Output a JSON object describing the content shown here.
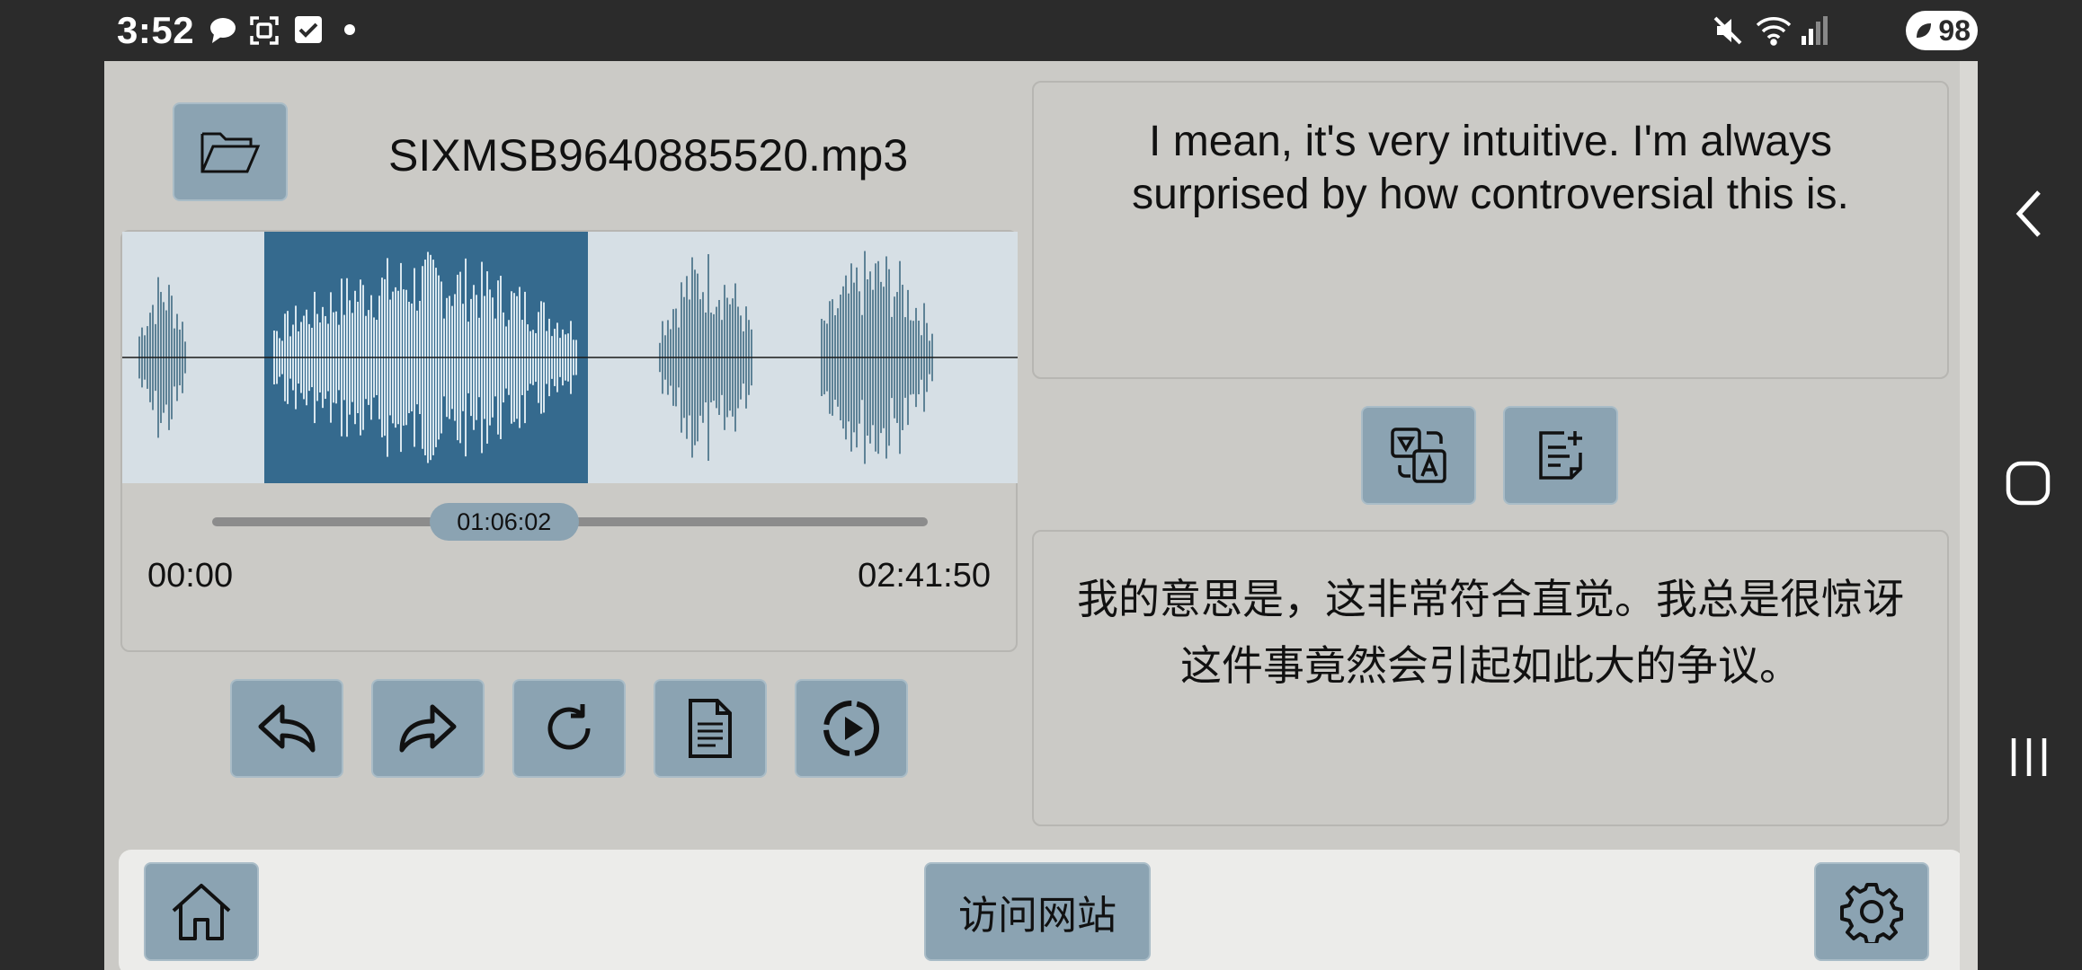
{
  "status_bar": {
    "time": "3:52",
    "battery": "98",
    "icons": [
      "chat-bubble-icon",
      "screenshot-icon",
      "checkbox-icon",
      "dot-icon",
      "mute-icon",
      "wifi-icon",
      "signal-icon",
      "battery-icon"
    ]
  },
  "player": {
    "file_name": "SIXMSB9640885520.mp3",
    "current_time": "01:06:02",
    "start_time": "00:00",
    "end_time": "02:41:50",
    "progress": 0.408,
    "selection_start": 0.159,
    "selection_end": 0.52
  },
  "transcript": {
    "english_line1": "I mean, it's very intuitive. I'm always",
    "english_line2": "surprised by how controversial this is.",
    "chinese_line1": "我的意思是，这非常符合直觉。我总是很惊讶",
    "chinese_line2": "这件事竟然会引起如此大的争议。"
  },
  "bottom_bar": {
    "visit_label": "访问网站"
  },
  "colors": {
    "app_bg": "#cbcac6",
    "button_bg": "#8ba3b2",
    "waveform_bg": "#d6dfe5",
    "waveform_selected": "#356a8e",
    "wave_bar": "#5e8296",
    "wave_bar_selected": "#d8e6ee"
  }
}
